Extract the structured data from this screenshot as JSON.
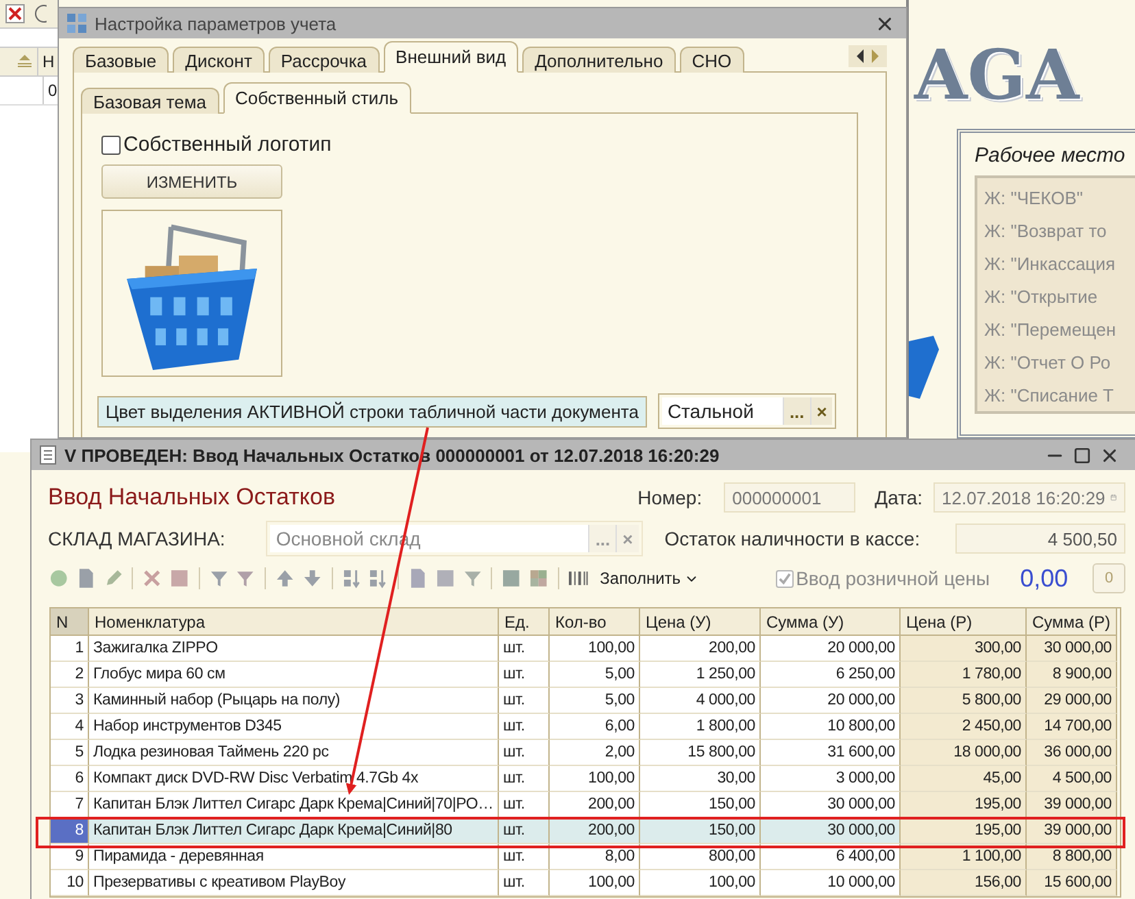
{
  "background_app": {
    "header_cell": "Н",
    "cell": "0"
  },
  "right_panel": {
    "logo": "AGA",
    "title": "Рабочее место",
    "items": [
      "Ж: \"ЧЕКОВ\"",
      "Ж: \"Возврат то",
      "Ж: \"Инкассация",
      "Ж: \"Открытие",
      "Ж: \"Перемещен",
      "Ж: \"Отчет О Ро",
      "Ж: \"Списание Т"
    ]
  },
  "settings_window": {
    "title": "Настройка параметров учета",
    "tabs": [
      {
        "label": "Базовые",
        "selected": false
      },
      {
        "label": "Дисконт",
        "selected": false
      },
      {
        "label": "Рассрочка",
        "selected": false
      },
      {
        "label": "Внешний вид",
        "selected": true
      },
      {
        "label": "Дополнительно",
        "selected": false
      },
      {
        "label": "СНО",
        "selected": false
      }
    ],
    "subtabs": [
      {
        "label": "Базовая тема",
        "selected": false
      },
      {
        "label": "Собственный стиль",
        "selected": true
      }
    ],
    "own_logo": {
      "label": "Собственный логотип",
      "checked": false
    },
    "change_button": "ИЗМЕНИТЬ",
    "highlight_color": {
      "label": "Цвет выделения АКТИВНОЙ строки табличной части документа",
      "value": "Стальной",
      "choose_button": "...",
      "clear_button": "×"
    }
  },
  "document_window": {
    "title": "V ПРОВЕДЕН: Ввод Начальных Остатков 000000001 от 12.07.2018 16:20:29",
    "heading": "Ввод Начальных Остатков",
    "number": {
      "label": "Номер:",
      "value": "000000001"
    },
    "date": {
      "label": "Дата:",
      "value": "12.07.2018 16:20:29"
    },
    "warehouse": {
      "label": "СКЛАД МАГАЗИНА:",
      "value": "Основной склад",
      "choose_button": "...",
      "clear_button": "×"
    },
    "cash": {
      "label": "Остаток наличности в кассе:",
      "value": "4 500,50"
    },
    "fill_button": "Заполнить",
    "retail_price": {
      "label": "Ввод розничной цены",
      "checked": true,
      "disabled": true
    },
    "total": "0,00",
    "counter": "0",
    "table": {
      "columns": [
        {
          "label": "N",
          "kind": "number"
        },
        {
          "label": "Номенклатура",
          "kind": "text"
        },
        {
          "label": "Ед.",
          "kind": "unit"
        },
        {
          "label": "Кол-во",
          "kind": "amount"
        },
        {
          "label": "Цена (У)",
          "kind": "amount"
        },
        {
          "label": "Сумма (У)",
          "kind": "amount"
        },
        {
          "label": "Цена (Р)",
          "kind": "retail"
        },
        {
          "label": "Сумма (Р)",
          "kind": "retail"
        }
      ],
      "rows": [
        {
          "selected": false,
          "cells": [
            "1",
            "Зажигалка ZIPPO",
            "шт.",
            "100,00",
            "200,00",
            "20 000,00",
            "300,00",
            "30 000,00"
          ]
        },
        {
          "selected": false,
          "cells": [
            "2",
            "Глобус мира 60 см",
            "шт.",
            "5,00",
            "1 250,00",
            "6 250,00",
            "1 780,00",
            "8 900,00"
          ]
        },
        {
          "selected": false,
          "cells": [
            "3",
            "Каминный набор (Рыцарь на полу)",
            "шт.",
            "5,00",
            "4 000,00",
            "20 000,00",
            "5 800,00",
            "29 000,00"
          ]
        },
        {
          "selected": false,
          "cells": [
            "4",
            "Набор инструментов D345",
            "шт.",
            "6,00",
            "1 800,00",
            "10 800,00",
            "2 450,00",
            "14 700,00"
          ]
        },
        {
          "selected": false,
          "cells": [
            "5",
            "Лодка резиновая Таймень 220 рс",
            "шт.",
            "2,00",
            "15 800,00",
            "31 600,00",
            "18 000,00",
            "36 000,00"
          ]
        },
        {
          "selected": false,
          "cells": [
            "6",
            "Компакт диск DVD-RW Disc Verbatim 4.7Gb 4x",
            "шт.",
            "100,00",
            "30,00",
            "3 000,00",
            "45,00",
            "4 500,00"
          ]
        },
        {
          "selected": false,
          "cells": [
            "7",
            "Капитан Блэк Литтел Сигарс Дарк Крема|Синий|70|РО…",
            "шт.",
            "200,00",
            "150,00",
            "30 000,00",
            "195,00",
            "39 000,00"
          ]
        },
        {
          "selected": true,
          "cells": [
            "8",
            "Капитан Блэк Литтел Сигарс Дарк Крема|Синий|80",
            "шт.",
            "200,00",
            "150,00",
            "30 000,00",
            "195,00",
            "39 000,00"
          ]
        },
        {
          "selected": false,
          "cells": [
            "9",
            "Пирамида - деревянная",
            "шт.",
            "8,00",
            "800,00",
            "6 400,00",
            "1 100,00",
            "8 800,00"
          ]
        },
        {
          "selected": false,
          "cells": [
            "10",
            "Презервативы с креативом PlayBoy",
            "шт.",
            "100,00",
            "100,00",
            "10 000,00",
            "156,00",
            "15 600,00"
          ]
        }
      ]
    }
  }
}
